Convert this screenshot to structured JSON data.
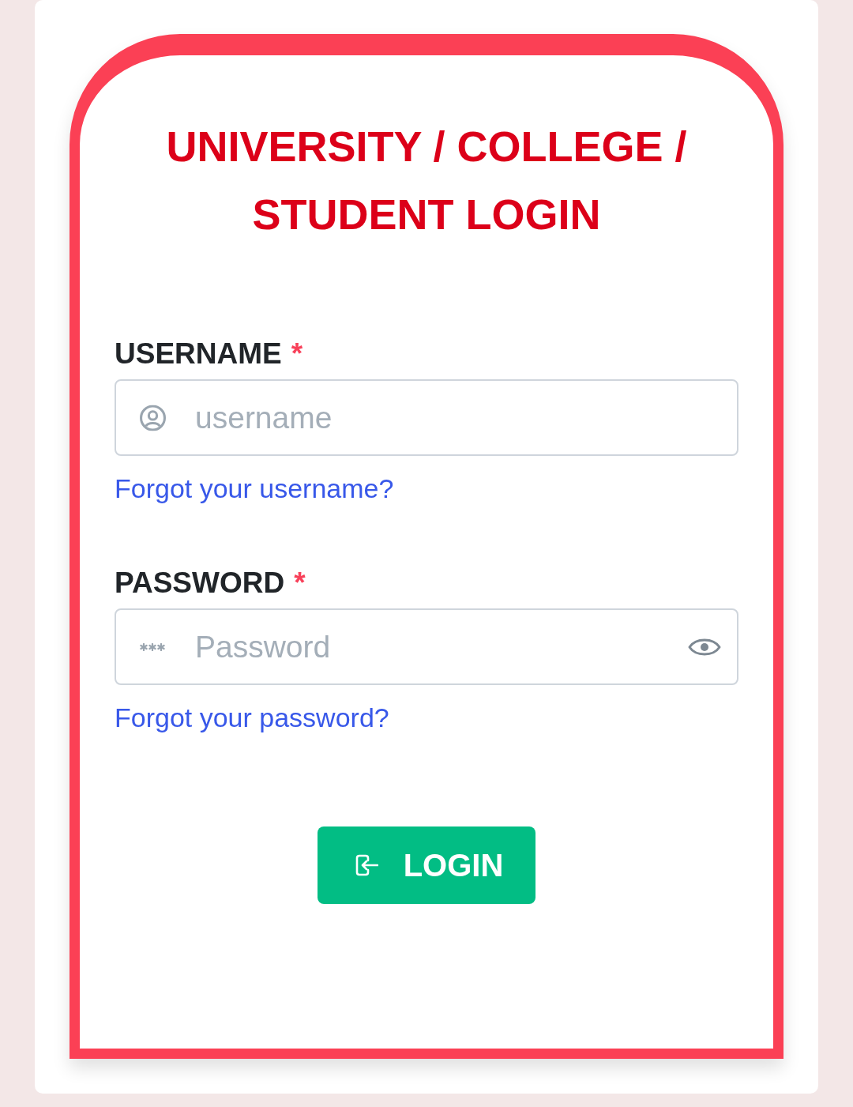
{
  "title": "UNIVERSITY / COLLEGE / STUDENT LOGIN",
  "fields": [
    {
      "kind": "text",
      "label": "USERNAME",
      "required_mark": "*",
      "placeholder": "username",
      "link": "Forgot your username?"
    },
    {
      "kind": "password",
      "label": "PASSWORD",
      "required_mark": "*",
      "placeholder": "Password",
      "link": "Forgot your password?"
    }
  ],
  "button": {
    "label": "LOGIN"
  }
}
